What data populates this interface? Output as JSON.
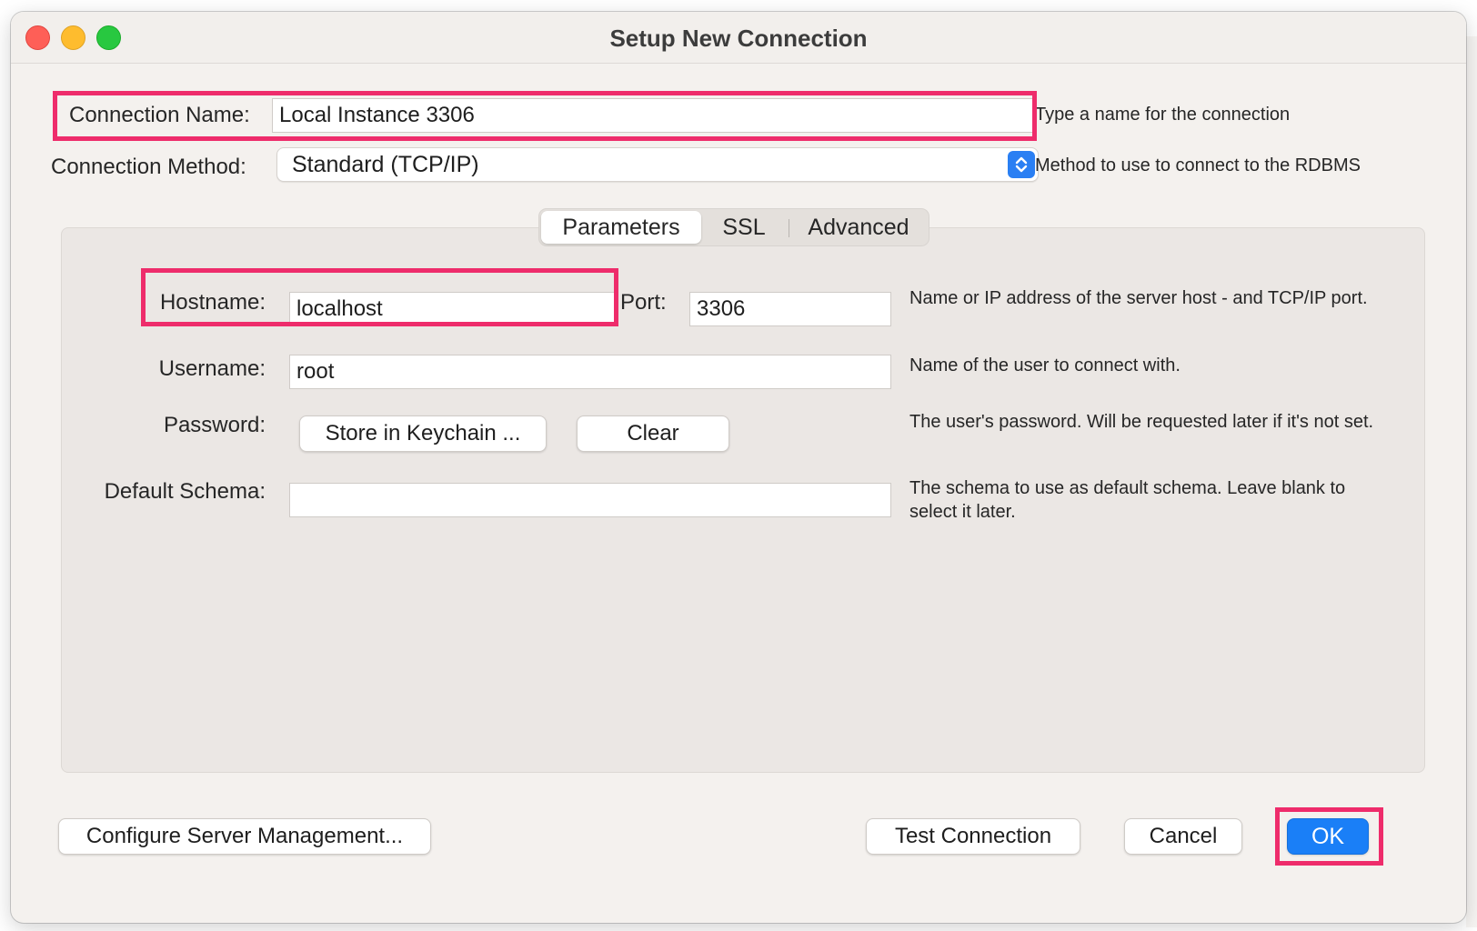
{
  "window": {
    "title": "Setup New Connection"
  },
  "connection_name": {
    "label": "Connection Name:",
    "value": "Local Instance 3306",
    "hint": "Type a name for the connection"
  },
  "connection_method": {
    "label": "Connection Method:",
    "value": "Standard (TCP/IP)",
    "hint": "Method to use to connect to the RDBMS"
  },
  "tabs": [
    {
      "label": "Parameters",
      "active": true
    },
    {
      "label": "SSL",
      "active": false
    },
    {
      "label": "Advanced",
      "active": false
    }
  ],
  "parameters": {
    "hostname": {
      "label": "Hostname:",
      "value": "localhost"
    },
    "port": {
      "label": "Port:",
      "value": "3306"
    },
    "host_hint": "Name or IP address of the server host - and TCP/IP port.",
    "username": {
      "label": "Username:",
      "value": "root",
      "hint": "Name of the user to connect with."
    },
    "password": {
      "label": "Password:",
      "store_label": "Store in Keychain ...",
      "clear_label": "Clear",
      "hint": "The user's password. Will be requested later if it's not set."
    },
    "default_schema": {
      "label": "Default Schema:",
      "value": "",
      "hint": "The schema to use as default schema. Leave blank to select it later."
    }
  },
  "footer": {
    "configure_label": "Configure Server Management...",
    "test_label": "Test Connection",
    "cancel_label": "Cancel",
    "ok_label": "OK"
  },
  "colors": {
    "accent": "#1a7ff7",
    "highlight": "#ee2c6b",
    "window_bg": "#f4f1ee"
  },
  "icons": {
    "method_select": "chevron-up-down-icon"
  }
}
